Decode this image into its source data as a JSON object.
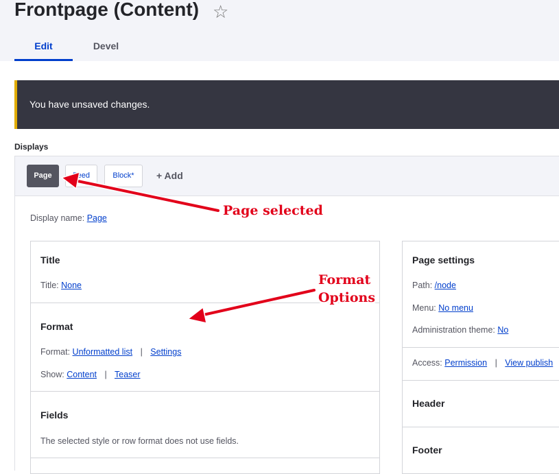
{
  "header": {
    "title": "Frontpage (Content)",
    "star_glyph": "☆",
    "tabs": [
      "Edit",
      "Devel"
    ]
  },
  "message": "You have unsaved changes.",
  "displays": {
    "label": "Displays",
    "tabs": [
      "Page",
      "Feed",
      "Block*"
    ],
    "add_label": "+ Add",
    "display_name_label": "Display name:",
    "display_name_value": "Page"
  },
  "left_column": {
    "title_section": {
      "heading": "Title",
      "label": "Title:",
      "value": "None"
    },
    "format_section": {
      "heading": "Format",
      "format_label": "Format:",
      "format_value": "Unformatted list",
      "format_settings": "Settings",
      "show_label": "Show:",
      "show_value": "Content",
      "show_option": "Teaser",
      "separator": "|"
    },
    "fields_section": {
      "heading": "Fields",
      "note": "The selected style or row format does not use fields."
    }
  },
  "right_column": {
    "heading": "Page settings",
    "path_label": "Path:",
    "path_value": "/node",
    "menu_label": "Menu:",
    "menu_value": "No menu",
    "admin_theme_label": "Administration theme:",
    "admin_theme_value": "No",
    "access_label": "Access:",
    "access_value": "Permission",
    "access_extra": "View publish",
    "separator": "|",
    "header_heading": "Header",
    "footer_heading": "Footer"
  },
  "annotations": {
    "page_selected": "Page selected",
    "format_options_line1": "Format",
    "format_options_line2": "Options",
    "color": "#e2001a"
  },
  "colors": {
    "link": "#003ecc",
    "message_bg": "#353641",
    "message_accent": "#e0ac00",
    "active_tab_bg": "#545560"
  }
}
